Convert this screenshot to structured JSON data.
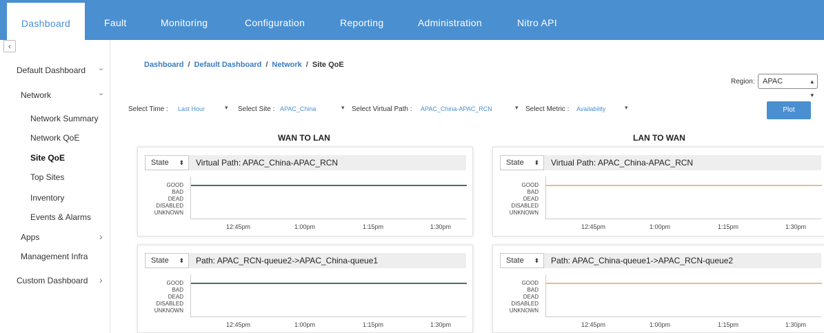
{
  "nav": {
    "items": [
      "Dashboard",
      "Fault",
      "Monitoring",
      "Configuration",
      "Reporting",
      "Administration",
      "Nitro API"
    ],
    "active": "Dashboard"
  },
  "sidebar": {
    "collapse_icon": "‹",
    "items": [
      {
        "label": "Default Dashboard",
        "chevron": "⌄"
      },
      {
        "label": "Network",
        "chevron": "⌄"
      },
      {
        "label": "Network Summary"
      },
      {
        "label": "Network QoE"
      },
      {
        "label": "Site QoE"
      },
      {
        "label": "Top Sites"
      },
      {
        "label": "Inventory"
      },
      {
        "label": "Events & Alarms"
      },
      {
        "label": "Apps",
        "chevron": "›"
      },
      {
        "label": "Management Infra"
      },
      {
        "label": "Custom Dashboard",
        "chevron": "›"
      }
    ]
  },
  "breadcrumb": [
    "Dashboard",
    "Default Dashboard",
    "Network",
    "Site QoE"
  ],
  "region": {
    "label": "Region:",
    "value": "APAC"
  },
  "filters": {
    "time_label": "Select Time :",
    "time_value": "Last Hour",
    "site_label": "Select Site :",
    "site_value": "APAC_China",
    "vpath_label": "Select Virtual Path :",
    "vpath_value": "APAC_China-APAC_RCN",
    "metric_label": "Select Metric :",
    "metric_value": "Availability"
  },
  "plot_button": "Plot",
  "sections": {
    "left": "WAN TO LAN",
    "right": "LAN TO WAN"
  },
  "panels": [
    {
      "state": "State",
      "title": "Virtual Path: APAC_China-APAC_RCN",
      "color": "#4a6e6a",
      "level": "GOOD"
    },
    {
      "state": "State",
      "title": "Virtual Path: APAC_China-APAC_RCN",
      "color": "#e0c08c",
      "level": "GOOD"
    },
    {
      "state": "State",
      "title": "Path: APAC_RCN-queue2->APAC_China-queue1",
      "color": "#4a6e6a",
      "level": "GOOD"
    },
    {
      "state": "State",
      "title": "Path: APAC_China-queue1->APAC_RCN-queue2",
      "color": "#e0c08c",
      "level": "GOOD"
    }
  ],
  "y_labels": [
    "GOOD",
    "BAD",
    "DEAD",
    "DISABLED",
    "UNKNOWN"
  ],
  "x_ticks": [
    "12:45pm",
    "1:00pm",
    "1:15pm",
    "1:30pm"
  ]
}
